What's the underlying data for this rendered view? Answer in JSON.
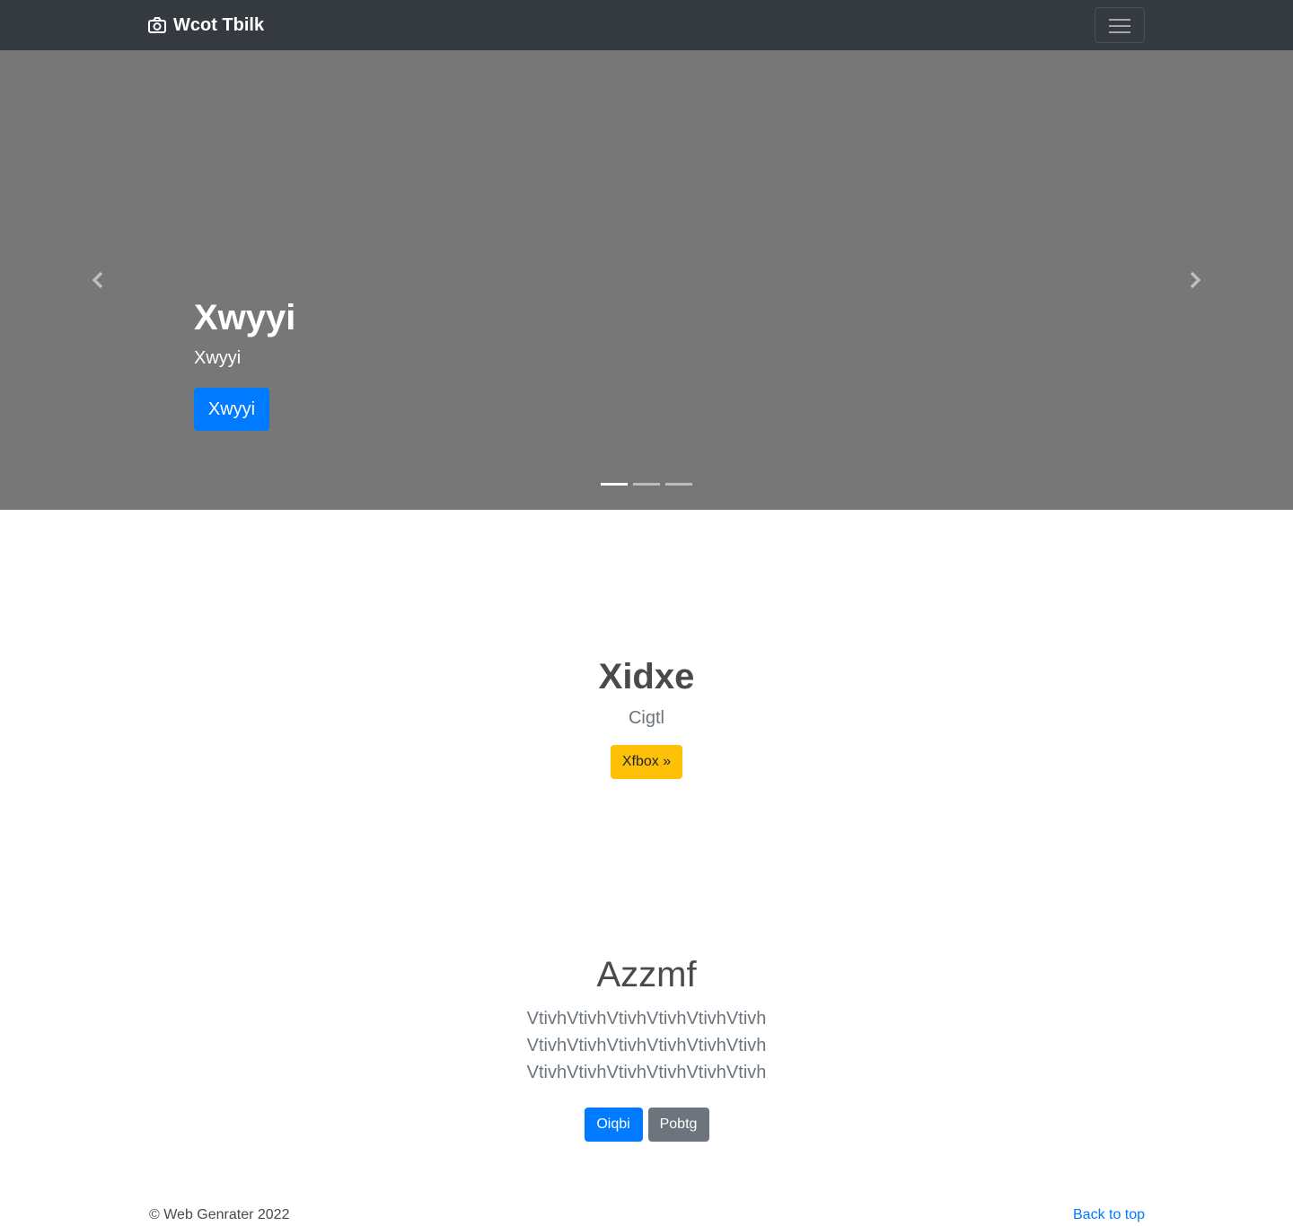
{
  "navbar": {
    "brand": "Wcot Tbilk",
    "brand_icon": "camera-icon",
    "toggler_icon": "hamburger-menu-icon"
  },
  "carousel": {
    "title": "Xwyyi",
    "subtitle": "Xwyyi",
    "button": "Xwyyi",
    "prev_icon": "chevron-left-icon",
    "next_icon": "chevron-right-icon",
    "indicators": [
      {
        "active": true
      },
      {
        "active": false
      },
      {
        "active": false
      }
    ],
    "background": "#777777"
  },
  "hero": {
    "title": "Xidxe",
    "subtitle": "Cigtl",
    "button": "Xfbox »"
  },
  "jumbotron": {
    "title": "Azzmf",
    "lead": "VtivhVtivhVtivhVtivhVtivhVtivh VtivhVtivhVtivhVtivhVtivhVtivh VtivhVtivhVtivhVtivhVtivhVtivh",
    "primary_button": "Oiqbi",
    "secondary_button": "Pobtg"
  },
  "footer": {
    "copyright": "© Web Genrater 2022",
    "back_to_top": "Back to top"
  },
  "colors": {
    "navbar": "#343a40",
    "primary": "#007bff",
    "secondary": "#6c757d",
    "warning": "#ffc107"
  }
}
